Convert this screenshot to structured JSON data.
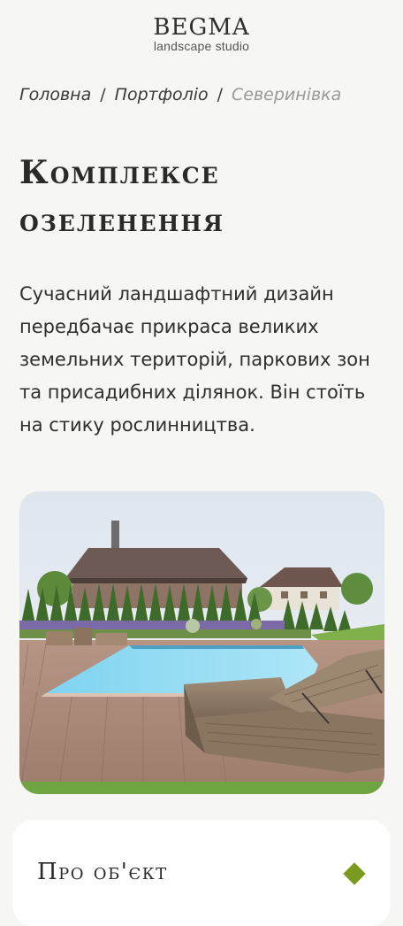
{
  "logo": {
    "title": "BEGMA",
    "subtitle": "landscape studio"
  },
  "breadcrumb": {
    "items": [
      "Головна",
      "Портфоліо",
      "Северинівка"
    ],
    "separator": "/"
  },
  "page": {
    "title": "Комплексе озеленення",
    "description": "Сучасний ландшафтний дизайн передбачає прикраса великих земельних територій, паркових зон та присадибних ділянок. Він стоїть на стику рослинництва."
  },
  "photo": {
    "subject": "house-with-pool-photo"
  },
  "info_card": {
    "title": "Про об'єкт",
    "accent_color": "#7a9b1e"
  }
}
